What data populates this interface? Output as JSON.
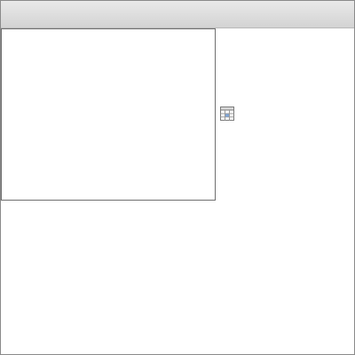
{
  "window": {
    "title": ""
  },
  "icons": {
    "calendar_button": "calendar-icon"
  },
  "colors": {
    "titlebar_top": "#e9e9e9",
    "titlebar_bottom": "#d3d3d3",
    "border": "#8a8a8a",
    "panel_border": "#6f6f6f",
    "calendar_accent": "#7fa6d8"
  }
}
